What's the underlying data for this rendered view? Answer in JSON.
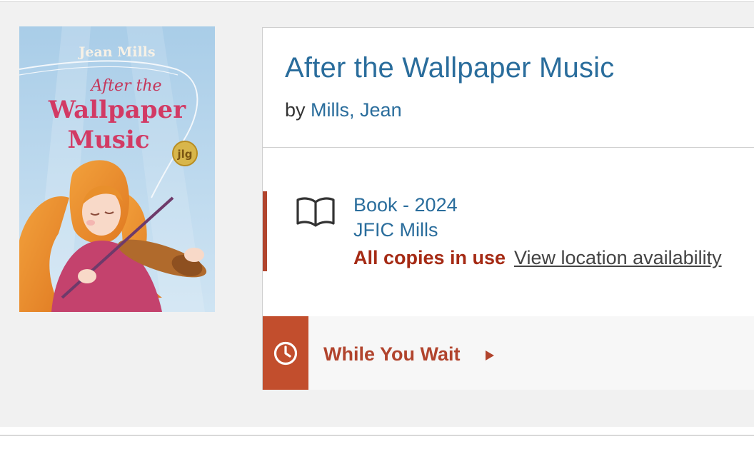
{
  "book": {
    "cover": {
      "author_text": "Jean Mills",
      "title_line1": "After the",
      "title_line2": "Wallpaper",
      "title_line3": "Music",
      "badge": "jlg"
    },
    "title": "After the Wallpaper Music",
    "by_label": "by",
    "author": "Mills, Jean"
  },
  "item": {
    "icon": "book-icon",
    "format": "Book - 2024",
    "call_number": "JFIC Mills",
    "status": "All copies in use",
    "availability_link": "View location availability"
  },
  "while_you_wait": {
    "icon": "clock-icon",
    "label": "While You Wait",
    "arrow": "caret-right-icon"
  },
  "colors": {
    "link": "#2a6d9c",
    "status": "#a52a14",
    "accent": "#c24e2d",
    "panel": "#f1f1f1"
  }
}
